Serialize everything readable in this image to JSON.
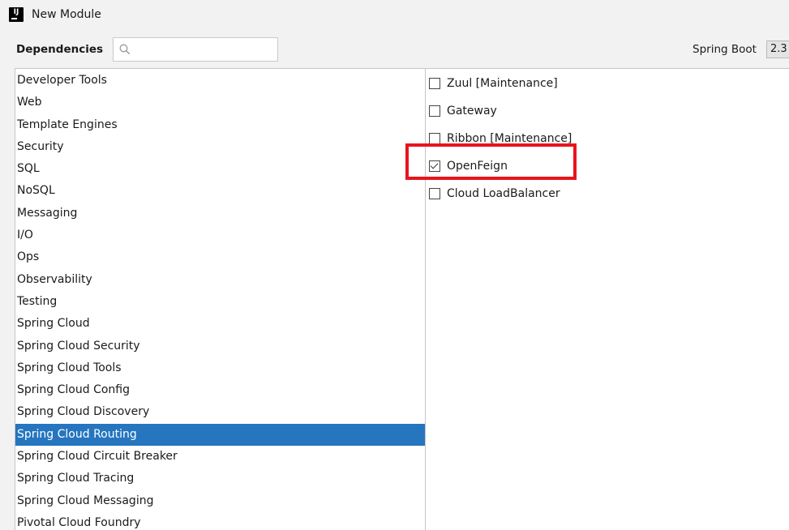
{
  "window": {
    "title": "New Module",
    "logo_text": "IJ"
  },
  "toolbar": {
    "dependencies_label": "Dependencies",
    "search": {
      "value": "",
      "placeholder": ""
    },
    "spring_boot_label": "Spring Boot",
    "spring_boot_version": "2.3"
  },
  "categories": [
    "Developer Tools",
    "Web",
    "Template Engines",
    "Security",
    "SQL",
    "NoSQL",
    "Messaging",
    "I/O",
    "Ops",
    "Observability",
    "Testing",
    "Spring Cloud",
    "Spring Cloud Security",
    "Spring Cloud Tools",
    "Spring Cloud Config",
    "Spring Cloud Discovery",
    "Spring Cloud Routing",
    "Spring Cloud Circuit Breaker",
    "Spring Cloud Tracing",
    "Spring Cloud Messaging",
    "Pivotal Cloud Foundry"
  ],
  "selected_category": "Spring Cloud Routing",
  "dependencies": [
    {
      "label": "Zuul [Maintenance]",
      "checked": false
    },
    {
      "label": "Gateway",
      "checked": false
    },
    {
      "label": "Ribbon [Maintenance]",
      "checked": false
    },
    {
      "label": "OpenFeign",
      "checked": true
    },
    {
      "label": "Cloud LoadBalancer",
      "checked": false
    }
  ],
  "colors": {
    "selection": "#2675bf",
    "highlight": "#e8141c"
  },
  "icons": {
    "search": "search-icon",
    "logo": "intellij-logo-icon"
  }
}
